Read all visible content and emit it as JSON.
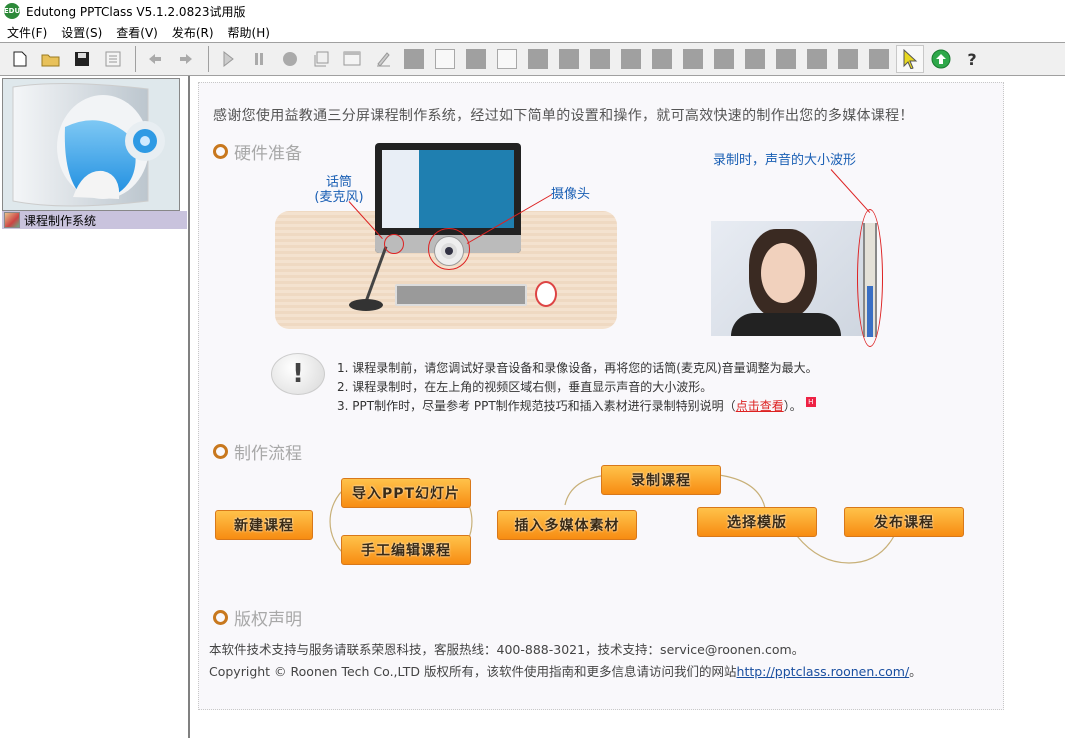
{
  "window": {
    "title": "Edutong PPTClass V5.1.2.0823试用版",
    "logo_text": "EDU"
  },
  "menu": [
    "文件(F)",
    "设置(S)",
    "查看(V)",
    "发布(R)",
    "帮助(H)"
  ],
  "toolbar": {
    "file_group": [
      "new-file-icon",
      "open-folder-icon",
      "save-icon",
      "properties-icon"
    ],
    "nav_group": [
      "back-arrow-icon",
      "forward-arrow-icon"
    ],
    "media_group": [
      "play-icon",
      "pause-icon",
      "record-icon",
      "crop-area-icon",
      "screen-icon",
      "pen-icon"
    ],
    "tool_squares": [
      "gray",
      "white",
      "gray",
      "white",
      "gray",
      "gray",
      "gray",
      "gray",
      "gray",
      "gray",
      "gray",
      "gray",
      "gray",
      "gray",
      "gray",
      "gray"
    ],
    "end_group": [
      "pointer-icon",
      "upload-icon",
      "help-icon"
    ]
  },
  "sidebar": {
    "tree_item": "课程制作系统"
  },
  "main": {
    "intro": "感谢您使用益教通三分屏课程制作系统，经过如下简单的设置和操作，就可高效快速的制作出您的多媒体课程！",
    "hardware": {
      "title": "硬件准备",
      "mic_label_1": "话筒",
      "mic_label_2": "(麦克风)",
      "camera_label": "摄像头",
      "wave_label": "录制时，声音的大小波形",
      "audio_level": 0.45
    },
    "tips": [
      "1. 课程录制前，请您调试好录音设备和录像设备，再将您的话筒(麦克风)音量调整为最大。",
      "2. 课程录制时，在左上角的视频区域右侧，垂直显示声音的大小波形。",
      "3. PPT制作时，尽量参考 PPT制作规范技巧和插入素材进行录制特别说明（"
    ],
    "tip_link": "点击查看",
    "tip_end": "）。",
    "flow": {
      "title": "制作流程",
      "steps": [
        "新建课程",
        "导入PPT幻灯片",
        "手工编辑课程",
        "插入多媒体素材",
        "录制课程",
        "选择模版",
        "发布课程"
      ]
    },
    "copyright": {
      "title": "版权声明",
      "line1": "本软件技术支持与服务请联系荣恩科技，客服热线：400-888-3021，技术支持：service@roonen.com。",
      "line2_prefix": "Copyright © Roonen Tech Co.,LTD 版权所有，该软件使用指南和更多信息请访问我们的网站",
      "link": "http://pptclass.roonen.com/",
      "line2_suffix": "。"
    }
  },
  "colors": {
    "accent_orange": "#f78c12",
    "section_ring": "#c8781e",
    "link_blue": "#1a4fa0",
    "label_blue": "#1a5fb4",
    "tree_selected": "#c9c3dd"
  }
}
